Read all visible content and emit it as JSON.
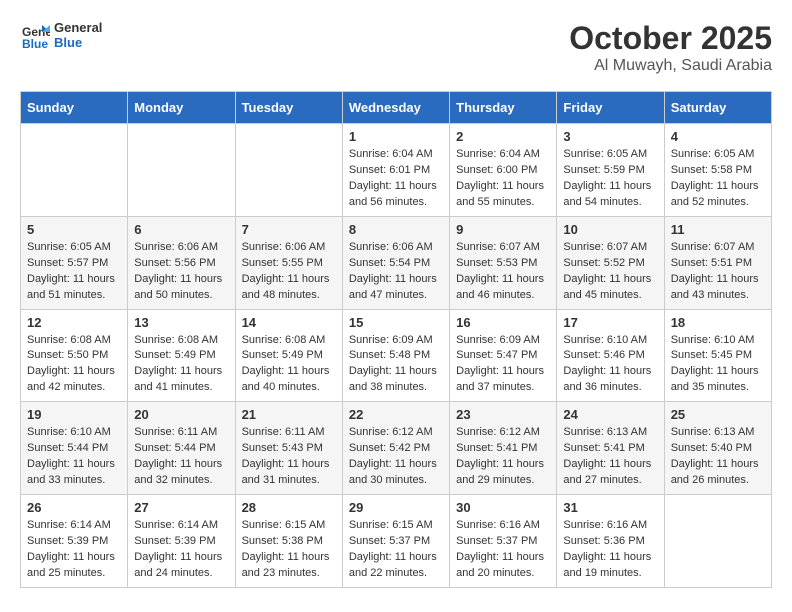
{
  "header": {
    "logo_line1": "General",
    "logo_line2": "Blue",
    "month": "October 2025",
    "location": "Al Muwayh, Saudi Arabia"
  },
  "weekdays": [
    "Sunday",
    "Monday",
    "Tuesday",
    "Wednesday",
    "Thursday",
    "Friday",
    "Saturday"
  ],
  "weeks": [
    [
      {
        "day": "",
        "sunrise": "",
        "sunset": "",
        "daylight": ""
      },
      {
        "day": "",
        "sunrise": "",
        "sunset": "",
        "daylight": ""
      },
      {
        "day": "",
        "sunrise": "",
        "sunset": "",
        "daylight": ""
      },
      {
        "day": "1",
        "sunrise": "Sunrise: 6:04 AM",
        "sunset": "Sunset: 6:01 PM",
        "daylight": "Daylight: 11 hours and 56 minutes."
      },
      {
        "day": "2",
        "sunrise": "Sunrise: 6:04 AM",
        "sunset": "Sunset: 6:00 PM",
        "daylight": "Daylight: 11 hours and 55 minutes."
      },
      {
        "day": "3",
        "sunrise": "Sunrise: 6:05 AM",
        "sunset": "Sunset: 5:59 PM",
        "daylight": "Daylight: 11 hours and 54 minutes."
      },
      {
        "day": "4",
        "sunrise": "Sunrise: 6:05 AM",
        "sunset": "Sunset: 5:58 PM",
        "daylight": "Daylight: 11 hours and 52 minutes."
      }
    ],
    [
      {
        "day": "5",
        "sunrise": "Sunrise: 6:05 AM",
        "sunset": "Sunset: 5:57 PM",
        "daylight": "Daylight: 11 hours and 51 minutes."
      },
      {
        "day": "6",
        "sunrise": "Sunrise: 6:06 AM",
        "sunset": "Sunset: 5:56 PM",
        "daylight": "Daylight: 11 hours and 50 minutes."
      },
      {
        "day": "7",
        "sunrise": "Sunrise: 6:06 AM",
        "sunset": "Sunset: 5:55 PM",
        "daylight": "Daylight: 11 hours and 48 minutes."
      },
      {
        "day": "8",
        "sunrise": "Sunrise: 6:06 AM",
        "sunset": "Sunset: 5:54 PM",
        "daylight": "Daylight: 11 hours and 47 minutes."
      },
      {
        "day": "9",
        "sunrise": "Sunrise: 6:07 AM",
        "sunset": "Sunset: 5:53 PM",
        "daylight": "Daylight: 11 hours and 46 minutes."
      },
      {
        "day": "10",
        "sunrise": "Sunrise: 6:07 AM",
        "sunset": "Sunset: 5:52 PM",
        "daylight": "Daylight: 11 hours and 45 minutes."
      },
      {
        "day": "11",
        "sunrise": "Sunrise: 6:07 AM",
        "sunset": "Sunset: 5:51 PM",
        "daylight": "Daylight: 11 hours and 43 minutes."
      }
    ],
    [
      {
        "day": "12",
        "sunrise": "Sunrise: 6:08 AM",
        "sunset": "Sunset: 5:50 PM",
        "daylight": "Daylight: 11 hours and 42 minutes."
      },
      {
        "day": "13",
        "sunrise": "Sunrise: 6:08 AM",
        "sunset": "Sunset: 5:49 PM",
        "daylight": "Daylight: 11 hours and 41 minutes."
      },
      {
        "day": "14",
        "sunrise": "Sunrise: 6:08 AM",
        "sunset": "Sunset: 5:49 PM",
        "daylight": "Daylight: 11 hours and 40 minutes."
      },
      {
        "day": "15",
        "sunrise": "Sunrise: 6:09 AM",
        "sunset": "Sunset: 5:48 PM",
        "daylight": "Daylight: 11 hours and 38 minutes."
      },
      {
        "day": "16",
        "sunrise": "Sunrise: 6:09 AM",
        "sunset": "Sunset: 5:47 PM",
        "daylight": "Daylight: 11 hours and 37 minutes."
      },
      {
        "day": "17",
        "sunrise": "Sunrise: 6:10 AM",
        "sunset": "Sunset: 5:46 PM",
        "daylight": "Daylight: 11 hours and 36 minutes."
      },
      {
        "day": "18",
        "sunrise": "Sunrise: 6:10 AM",
        "sunset": "Sunset: 5:45 PM",
        "daylight": "Daylight: 11 hours and 35 minutes."
      }
    ],
    [
      {
        "day": "19",
        "sunrise": "Sunrise: 6:10 AM",
        "sunset": "Sunset: 5:44 PM",
        "daylight": "Daylight: 11 hours and 33 minutes."
      },
      {
        "day": "20",
        "sunrise": "Sunrise: 6:11 AM",
        "sunset": "Sunset: 5:44 PM",
        "daylight": "Daylight: 11 hours and 32 minutes."
      },
      {
        "day": "21",
        "sunrise": "Sunrise: 6:11 AM",
        "sunset": "Sunset: 5:43 PM",
        "daylight": "Daylight: 11 hours and 31 minutes."
      },
      {
        "day": "22",
        "sunrise": "Sunrise: 6:12 AM",
        "sunset": "Sunset: 5:42 PM",
        "daylight": "Daylight: 11 hours and 30 minutes."
      },
      {
        "day": "23",
        "sunrise": "Sunrise: 6:12 AM",
        "sunset": "Sunset: 5:41 PM",
        "daylight": "Daylight: 11 hours and 29 minutes."
      },
      {
        "day": "24",
        "sunrise": "Sunrise: 6:13 AM",
        "sunset": "Sunset: 5:41 PM",
        "daylight": "Daylight: 11 hours and 27 minutes."
      },
      {
        "day": "25",
        "sunrise": "Sunrise: 6:13 AM",
        "sunset": "Sunset: 5:40 PM",
        "daylight": "Daylight: 11 hours and 26 minutes."
      }
    ],
    [
      {
        "day": "26",
        "sunrise": "Sunrise: 6:14 AM",
        "sunset": "Sunset: 5:39 PM",
        "daylight": "Daylight: 11 hours and 25 minutes."
      },
      {
        "day": "27",
        "sunrise": "Sunrise: 6:14 AM",
        "sunset": "Sunset: 5:39 PM",
        "daylight": "Daylight: 11 hours and 24 minutes."
      },
      {
        "day": "28",
        "sunrise": "Sunrise: 6:15 AM",
        "sunset": "Sunset: 5:38 PM",
        "daylight": "Daylight: 11 hours and 23 minutes."
      },
      {
        "day": "29",
        "sunrise": "Sunrise: 6:15 AM",
        "sunset": "Sunset: 5:37 PM",
        "daylight": "Daylight: 11 hours and 22 minutes."
      },
      {
        "day": "30",
        "sunrise": "Sunrise: 6:16 AM",
        "sunset": "Sunset: 5:37 PM",
        "daylight": "Daylight: 11 hours and 20 minutes."
      },
      {
        "day": "31",
        "sunrise": "Sunrise: 6:16 AM",
        "sunset": "Sunset: 5:36 PM",
        "daylight": "Daylight: 11 hours and 19 minutes."
      },
      {
        "day": "",
        "sunrise": "",
        "sunset": "",
        "daylight": ""
      }
    ]
  ]
}
